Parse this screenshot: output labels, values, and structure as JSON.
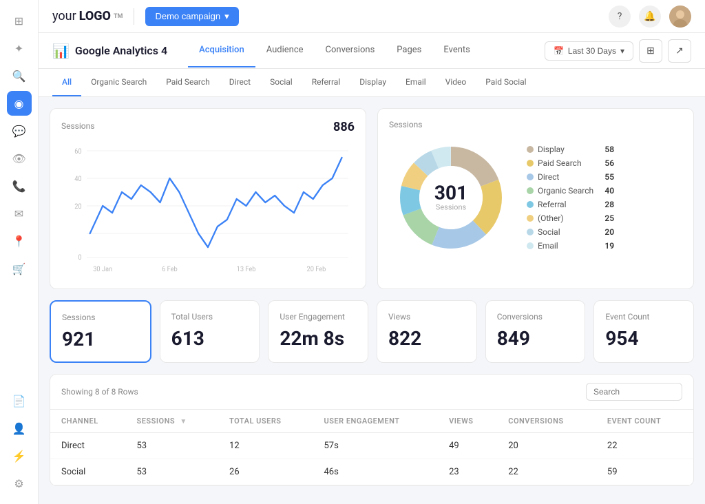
{
  "topbar": {
    "logo_text": "your",
    "logo_bold": "LOGO",
    "logo_tm": "TM",
    "demo_btn": "Demo campaign",
    "icons": [
      "?",
      "🔔",
      "👤"
    ]
  },
  "analytics": {
    "icon": "📊",
    "title": "Google Analytics 4",
    "nav_tabs": [
      "Acquisition",
      "Audience",
      "Conversions",
      "Pages",
      "Events"
    ],
    "active_tab": "Acquisition",
    "date_btn": "Last 30 Days",
    "channel_tabs": [
      "All",
      "Organic Search",
      "Paid Search",
      "Direct",
      "Social",
      "Referral",
      "Display",
      "Email",
      "Video",
      "Paid Social"
    ],
    "active_channel": "All"
  },
  "line_chart": {
    "title": "Sessions",
    "value": "886",
    "x_labels": [
      "30 Jan",
      "6 Feb",
      "13 Feb",
      "20 Feb"
    ],
    "y_labels": [
      "60",
      "40",
      "20",
      "0"
    ]
  },
  "donut_chart": {
    "title": "Sessions",
    "center_value": "301",
    "center_label": "Sessions",
    "segments": [
      {
        "label": "Display",
        "value": 58,
        "color": "#c8b8a2"
      },
      {
        "label": "Paid Search",
        "value": 56,
        "color": "#e8c96a"
      },
      {
        "label": "Direct",
        "value": 55,
        "color": "#a8c8e8"
      },
      {
        "label": "Organic Search",
        "value": 40,
        "color": "#a8d4a8"
      },
      {
        "label": "Referral",
        "value": 28,
        "color": "#7ec8e3"
      },
      {
        "label": "(Other)",
        "value": 25,
        "color": "#f0d080"
      },
      {
        "label": "Social",
        "value": 20,
        "color": "#b8d8e8"
      },
      {
        "label": "Email",
        "value": 19,
        "color": "#d0e8f0"
      }
    ]
  },
  "metrics": [
    {
      "label": "Sessions",
      "value": "921",
      "selected": true
    },
    {
      "label": "Total Users",
      "value": "613",
      "selected": false
    },
    {
      "label": "User Engagement",
      "value": "22m 8s",
      "selected": false
    },
    {
      "label": "Views",
      "value": "822",
      "selected": false
    },
    {
      "label": "Conversions",
      "value": "849",
      "selected": false
    },
    {
      "label": "Event Count",
      "value": "954",
      "selected": false
    }
  ],
  "table": {
    "subtitle": "Showing 8 of 8 Rows",
    "search_placeholder": "Search",
    "columns": [
      "Channel",
      "Sessions",
      "Total Users",
      "User Engagement",
      "Views",
      "Conversions",
      "Event Count"
    ],
    "rows": [
      {
        "channel": "Direct",
        "sessions": "53",
        "users": "12",
        "engagement": "57s",
        "views": "49",
        "conversions": "20",
        "events": "22"
      },
      {
        "channel": "Social",
        "sessions": "53",
        "users": "26",
        "engagement": "46s",
        "views": "23",
        "conversions": "22",
        "events": "59"
      }
    ]
  },
  "sidebar_icons": [
    "⊞",
    "⊕",
    "🔍",
    "◉",
    "💬",
    "👁",
    "📞",
    "✉",
    "📍",
    "🛒",
    "📄",
    "👤",
    "⚡",
    "⚙"
  ]
}
